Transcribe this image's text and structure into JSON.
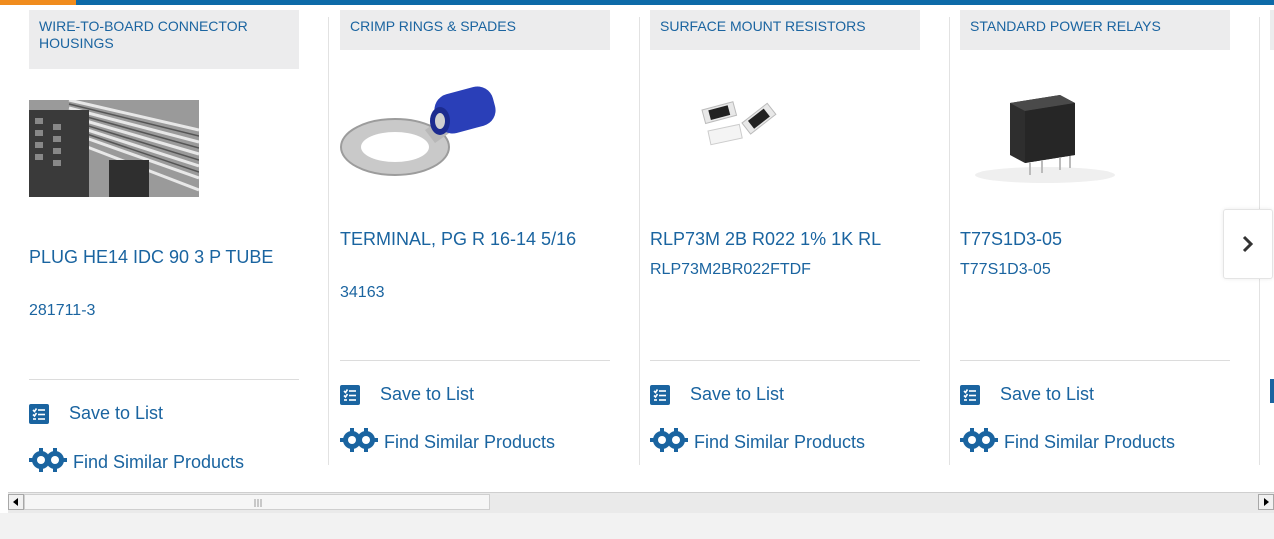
{
  "cards": [
    {
      "category": "WIRE-TO-BOARD CONNECTOR HOUSINGS",
      "title": "PLUG HE14 IDC 90 3 P TUBE",
      "part_number": "281711-3",
      "image": "connector-housing-photo"
    },
    {
      "category": "CRIMP RINGS & SPADES",
      "title": "TERMINAL, PG R 16-14 5/16",
      "part_number": "34163",
      "image": "ring-terminal-photo"
    },
    {
      "category": "SURFACE MOUNT RESISTORS",
      "title": "RLP73M 2B R022 1% 1K RL",
      "part_number": "RLP73M2BR022FTDF",
      "image": "smd-resistor-photo"
    },
    {
      "category": "STANDARD POWER RELAYS",
      "title": "T77S1D3-05",
      "part_number": "T77S1D3-05",
      "image": "power-relay-photo"
    }
  ],
  "actions": {
    "save_to_list": "Save to List",
    "find_similar": "Find Similar Products"
  },
  "colors": {
    "brand_blue": "#1a64a0",
    "accent_orange": "#f08c1e",
    "category_bg": "#ececed"
  },
  "icons": {
    "next": "chevron-right-icon",
    "save": "checklist-icon",
    "find_similar": "gears-icon"
  }
}
